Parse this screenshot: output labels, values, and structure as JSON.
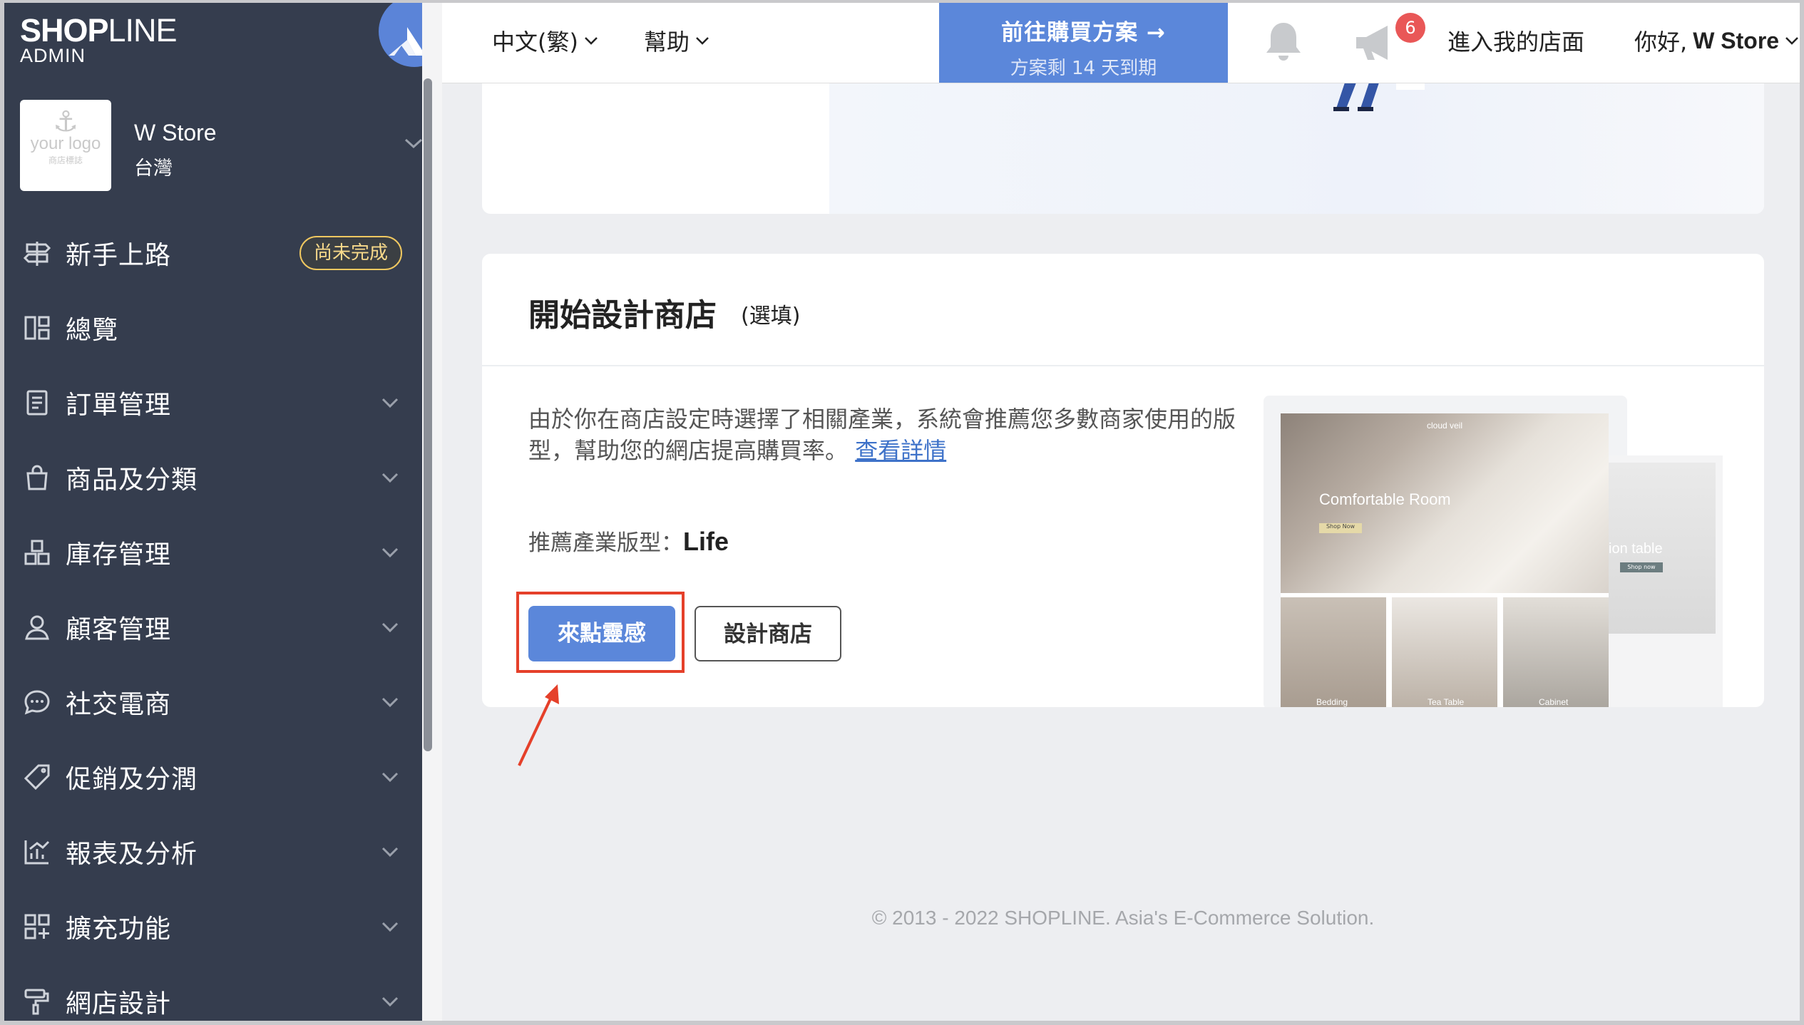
{
  "brand": {
    "logo": "SHOPLINE",
    "logo_bold": "SHOP",
    "logo_o": "O",
    "logo_thin": "LINE",
    "sub": "ADMIN"
  },
  "store": {
    "name": "W Store",
    "region": "台灣",
    "logo_text": "your logo",
    "logo_sub": "商店標誌"
  },
  "nav": [
    {
      "label": "新手上路",
      "icon": "signpost-icon",
      "badge": "尚未完成"
    },
    {
      "label": "總覽",
      "icon": "dashboard-icon"
    },
    {
      "label": "訂單管理",
      "icon": "order-list-icon",
      "expandable": true
    },
    {
      "label": "商品及分類",
      "icon": "shopping-bag-icon",
      "expandable": true
    },
    {
      "label": "庫存管理",
      "icon": "inventory-boxes-icon",
      "expandable": true
    },
    {
      "label": "顧客管理",
      "icon": "user-icon",
      "expandable": true
    },
    {
      "label": "社交電商",
      "icon": "chat-bubble-icon",
      "expandable": true
    },
    {
      "label": "促銷及分潤",
      "icon": "tag-icon",
      "expandable": true
    },
    {
      "label": "報表及分析",
      "icon": "chart-icon",
      "expandable": true
    },
    {
      "label": "擴充功能",
      "icon": "apps-grid-icon",
      "expandable": true
    },
    {
      "label": "網店設計",
      "icon": "paint-roller-icon",
      "expandable": true
    }
  ],
  "topbar": {
    "language": "中文(繁)",
    "help": "幫助",
    "plan_cta": "前往購買方案 →",
    "plan_remaining": "方案剩 14 天到期",
    "notifications_count": "6",
    "visit_store": "進入我的店面",
    "greeting_prefix": "你好,",
    "greeting_name": "W Store"
  },
  "design_card": {
    "title": "開始設計商店",
    "title_optional": "(選填)",
    "description": "由於你在商店設定時選擇了相關產業，系統會推薦您多數商家使用的版型，幫助您的網店提高購買率。",
    "details_link": "查看詳情",
    "recommend_label": "推薦產業版型：",
    "recommend_value": "Life",
    "primary_button": "來點靈感",
    "secondary_button": "設計商店",
    "preview": {
      "site_name": "cloud veil",
      "hero_title": "Comfortable Room",
      "hero_button": "Shop Now",
      "tiles": [
        "Bedding",
        "Tea Table",
        "Cabinet"
      ],
      "side_title": "ion table",
      "side_button": "Shop now"
    }
  },
  "footer": "© 2013 - 2022 SHOPLINE. Asia's E-Commerce Solution.",
  "colors": {
    "sidebar": "#353d4e",
    "accent": "#5b87da",
    "highlight": "#e5402a",
    "badge": "#f0c860"
  }
}
